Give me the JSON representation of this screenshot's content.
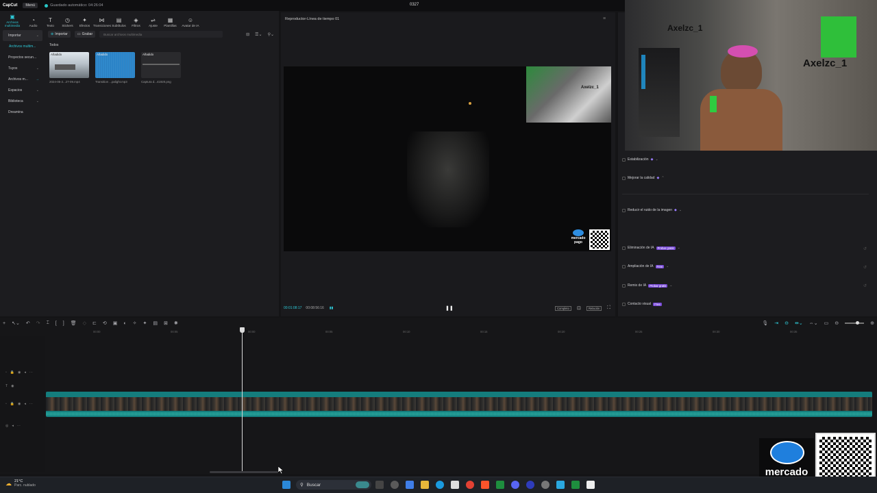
{
  "titlebar": {
    "app": "CapCut",
    "menu": "Menú",
    "saved": "Guardado automático: 04:26:04",
    "project": "0327"
  },
  "tools": [
    {
      "label": "Archivos multimedia",
      "icon": "media-icon"
    },
    {
      "label": "Audio",
      "icon": "audio-icon"
    },
    {
      "label": "Texto",
      "icon": "text-icon"
    },
    {
      "label": "Stickers",
      "icon": "sticker-icon"
    },
    {
      "label": "Efectos",
      "icon": "effects-icon"
    },
    {
      "label": "Transiciones",
      "icon": "transition-icon"
    },
    {
      "label": "Subtítulos",
      "icon": "subtitles-icon"
    },
    {
      "label": "Filtros",
      "icon": "filters-icon"
    },
    {
      "label": "Ajuste",
      "icon": "adjust-icon"
    },
    {
      "label": "Plantillas",
      "icon": "templates-icon"
    },
    {
      "label": "Avatar de IA",
      "icon": "avatar-icon"
    }
  ],
  "leftnav": [
    {
      "label": "Importar",
      "active": true
    },
    {
      "label": "Archivos multim...",
      "sub": true
    },
    {
      "label": "Proyectos secun..."
    },
    {
      "label": "Tuyos"
    },
    {
      "label": "Archivos m..."
    },
    {
      "label": "Espacios"
    },
    {
      "label": "Biblioteca"
    },
    {
      "label": "Dreamina"
    }
  ],
  "media": {
    "import_btn": "Importar",
    "record_btn": "Grabar",
    "search_placeholder": "Buscar archivos multimedia",
    "filter": "Todos",
    "items": [
      {
        "tag": "Añadido",
        "name": "2024-05-2...27-09.mp4"
      },
      {
        "tag": "Añadido",
        "name": "Transition ...palight.mp3"
      },
      {
        "tag": "Añadido",
        "name": "Captura d...41920.png"
      }
    ]
  },
  "player": {
    "title": "Reproductor-Línea de tiempo 01",
    "current_time": "00:01:08:17",
    "total_time": "00:08:56:16",
    "btn_compare": "Completo",
    "btn_ratio": "Relación",
    "overlay_name": "Axelzc_1",
    "brand_line1": "mercado",
    "brand_line2": "pago"
  },
  "properties": [
    {
      "label": "Estabilización"
    },
    {
      "label": "Mejorar la calidad"
    },
    {
      "label": "Reducir el ruido de la imagen"
    },
    {
      "label": "Eliminación de IA",
      "pill": "Probar gratis"
    },
    {
      "label": "Ampliación de IA",
      "pill": "Free"
    },
    {
      "label": "Remix de IA",
      "pill": "Probar gratis"
    },
    {
      "label": "Contacto visual",
      "pill": "Free"
    }
  ],
  "timeline": {
    "ticks": [
      "00:00",
      "00:05",
      "00:00",
      "00:05",
      "00:10",
      "00:15",
      "00:20",
      "00:25",
      "00:30",
      "00:35"
    ]
  },
  "webcam": {
    "channel": "Axelzc_1",
    "channel_big": "Axelzc_1"
  },
  "overlay": {
    "mp_line1": "mercado",
    "mp_line2": "pago"
  },
  "taskbar": {
    "temp": "21°C",
    "weather": "Parc. nublado",
    "search": "Buscar"
  }
}
